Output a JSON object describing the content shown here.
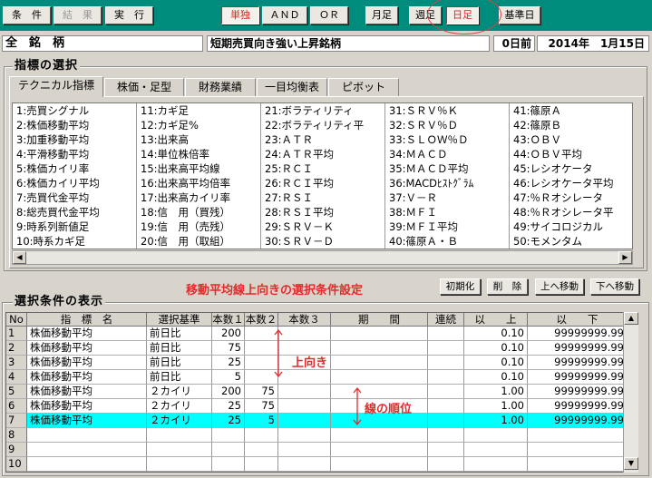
{
  "toolbar": {
    "buttons": [
      "条　件",
      "結　果",
      "実　行",
      "単独",
      "ＡＮＤ",
      "ＯＲ",
      "月足",
      "週足",
      "日足",
      "基準日"
    ]
  },
  "header": {
    "left": "全　銘　柄",
    "screen": "短期売買向き強い上昇銘柄",
    "days": "0日前",
    "date": "2014年　1月15日"
  },
  "indicator_section": {
    "title": "指標の選択",
    "tabs": [
      "テクニカル指標",
      "株価・足型",
      "財務業績",
      "一目均衡表",
      "ピボット"
    ],
    "columns": [
      [
        "1:売買シグナル",
        "2:株価移動平均",
        "3:加重移動平均",
        "4:平滑移動平均",
        "5:株価カイリ率",
        "6:株価カイリ平均",
        "7:売買代金平均",
        "8:総売買代金平均",
        "9:時系列新値足",
        "10:時系カギ足"
      ],
      [
        "11:カギ足",
        "12:カギ足%",
        "13:出来高",
        "14:単位株倍率",
        "15:出来高平均線",
        "16:出来高平均倍率",
        "17:出来高カイリ率",
        "18:信　用（買残）",
        "19:信　用（売残）",
        "20:信　用（取組）"
      ],
      [
        "21:ボラティリティ",
        "22:ボラティリティ平",
        "23:ＡＴＲ",
        "24:ＡＴＲ平均",
        "25:ＲＣＩ",
        "26:ＲＣＩ平均",
        "27:ＲＳＩ",
        "28:ＲＳＩ平均",
        "29:ＳＲＶ－Ｋ",
        "30:ＳＲＶ－Ｄ"
      ],
      [
        "31:ＳＲＶ％Ｋ",
        "32:ＳＲＶ％Ｄ",
        "33:ＳＬＯＷ％Ｄ",
        "34:ＭＡＣＤ",
        "35:ＭＡＣＤ平均",
        "36:MACDﾋｽﾄｸﾞﾗﾑ",
        "37:Ｖ－Ｒ",
        "38:ＭＦＩ",
        "39:ＭＦＩ平均",
        "40:篠原Ａ・Ｂ"
      ],
      [
        "41:篠原Ａ",
        "42:篠原Ｂ",
        "43:ＯＢＶ",
        "44:ＯＢＶ平均",
        "45:レシオケータ",
        "46:レシオケータ平均",
        "47:％Ｒオシレータ",
        "48:％Ｒオシレータ平",
        "49:サイコロジカル",
        "50:モメンタム"
      ]
    ]
  },
  "selection_section": {
    "title": "選択条件の表示",
    "banner": "移動平均線上向きの選択条件設定",
    "buttons": [
      "初期化",
      "削　除",
      "上へ移動",
      "下へ移動"
    ],
    "headers": [
      "No",
      "指　標　名",
      "選択基準",
      "本数１",
      "本数２",
      "本数３",
      "期　　間",
      "連続",
      "以　　上",
      "以　　下"
    ],
    "rows": [
      {
        "no": "1",
        "name": "株価移動平均",
        "basis": "前日比",
        "n1": "200",
        "n2": "",
        "n3": "",
        "period": "",
        "cont": "",
        "min": "0.10",
        "max": "99999999.99"
      },
      {
        "no": "2",
        "name": "株価移動平均",
        "basis": "前日比",
        "n1": "75",
        "n2": "",
        "n3": "",
        "period": "",
        "cont": "",
        "min": "0.10",
        "max": "99999999.99"
      },
      {
        "no": "3",
        "name": "株価移動平均",
        "basis": "前日比",
        "n1": "25",
        "n2": "",
        "n3": "",
        "period": "",
        "cont": "",
        "min": "0.10",
        "max": "99999999.99"
      },
      {
        "no": "4",
        "name": "株価移動平均",
        "basis": "前日比",
        "n1": "5",
        "n2": "",
        "n3": "",
        "period": "",
        "cont": "",
        "min": "0.10",
        "max": "99999999.99"
      },
      {
        "no": "5",
        "name": "株価移動平均",
        "basis": "２カイリ",
        "n1": "200",
        "n2": "75",
        "n3": "",
        "period": "",
        "cont": "",
        "min": "1.00",
        "max": "99999999.99"
      },
      {
        "no": "6",
        "name": "株価移動平均",
        "basis": "２カイリ",
        "n1": "25",
        "n2": "75",
        "n3": "",
        "period": "",
        "cont": "",
        "min": "1.00",
        "max": "99999999.99"
      },
      {
        "no": "7",
        "name": "株価移動平均",
        "basis": "２カイリ",
        "n1": "25",
        "n2": "5",
        "n3": "",
        "period": "",
        "cont": "",
        "min": "1.00",
        "max": "99999999.99"
      },
      {
        "no": "8",
        "name": "",
        "basis": "",
        "n1": "",
        "n2": "",
        "n3": "",
        "period": "",
        "cont": "",
        "min": "",
        "max": ""
      },
      {
        "no": "9",
        "name": "",
        "basis": "",
        "n1": "",
        "n2": "",
        "n3": "",
        "period": "",
        "cont": "",
        "min": "",
        "max": ""
      },
      {
        "no": "10",
        "name": "",
        "basis": "",
        "n1": "",
        "n2": "",
        "n3": "",
        "period": "",
        "cont": "",
        "min": "",
        "max": ""
      }
    ],
    "selected_row": 7,
    "highlight_color": "#00ffff",
    "annotations": [
      "上向き",
      "線の順位"
    ]
  },
  "colors": {
    "toolbar": "#008c7c",
    "accent_red": "#e42a2a"
  }
}
